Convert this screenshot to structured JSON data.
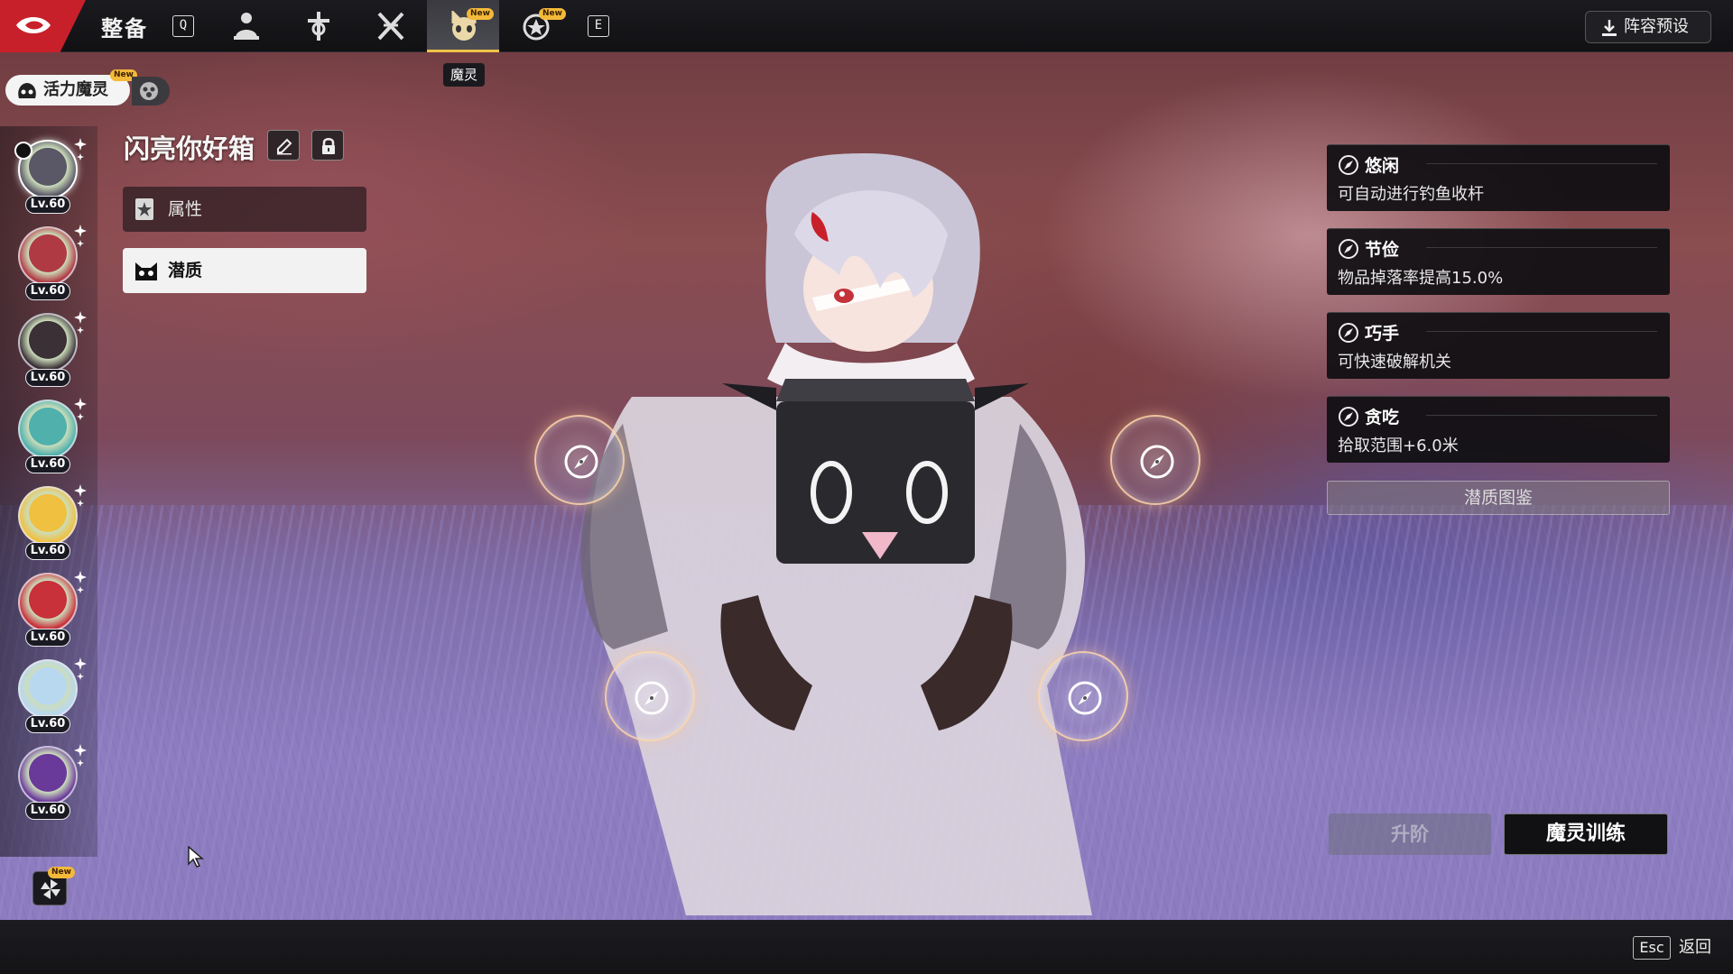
{
  "topbar": {
    "title": "整备",
    "key_left": "Q",
    "key_right": "E",
    "tabs": [
      {
        "name": "character-icon",
        "active": false,
        "new": false
      },
      {
        "name": "weapon-icon",
        "active": false,
        "new": false
      },
      {
        "name": "crossed-swords-icon",
        "active": false,
        "new": false
      },
      {
        "name": "pet-icon",
        "active": true,
        "new": true
      },
      {
        "name": "medal-icon",
        "active": false,
        "new": true
      }
    ],
    "new_badge": "New",
    "active_tab_tooltip": "魔灵",
    "preset_label": "阵容预设"
  },
  "filter": {
    "label": "活力魔灵",
    "new_badge": "New"
  },
  "pet_list": [
    {
      "level": "Lv.60",
      "color": "#5a5866",
      "selected": true
    },
    {
      "level": "Lv.60",
      "color": "#b03a44",
      "selected": false
    },
    {
      "level": "Lv.60",
      "color": "#3a3036",
      "selected": false
    },
    {
      "level": "Lv.60",
      "color": "#4fb0ac",
      "selected": false
    },
    {
      "level": "Lv.60",
      "color": "#f0c040",
      "selected": false
    },
    {
      "level": "Lv.60",
      "color": "#c8303a",
      "selected": false
    },
    {
      "level": "Lv.60",
      "color": "#b8d8f0",
      "selected": false
    },
    {
      "level": "Lv.60",
      "color": "#6a3a9a",
      "selected": false
    }
  ],
  "dex_new_badge": "New",
  "pet_name": "闪亮你好箱",
  "menu": {
    "attributes": "属性",
    "potential": "潜质"
  },
  "traits": [
    {
      "name": "悠闲",
      "desc": "可自动进行钓鱼收杆"
    },
    {
      "name": "节俭",
      "desc": "物品掉落率提高15.0%"
    },
    {
      "name": "巧手",
      "desc": "可快速破解机关"
    },
    {
      "name": "贪吃",
      "desc": "拾取范围+6.0米"
    }
  ],
  "codex_label": "潜质图鉴",
  "buttons": {
    "ascend": "升阶",
    "train": "魔灵训练"
  },
  "footer": {
    "esc_key": "Esc",
    "back": "返回"
  },
  "colors": {
    "accent_red": "#c8202a",
    "tab_highlight": "#f0c24a",
    "new_badge": "#f4b93a"
  }
}
